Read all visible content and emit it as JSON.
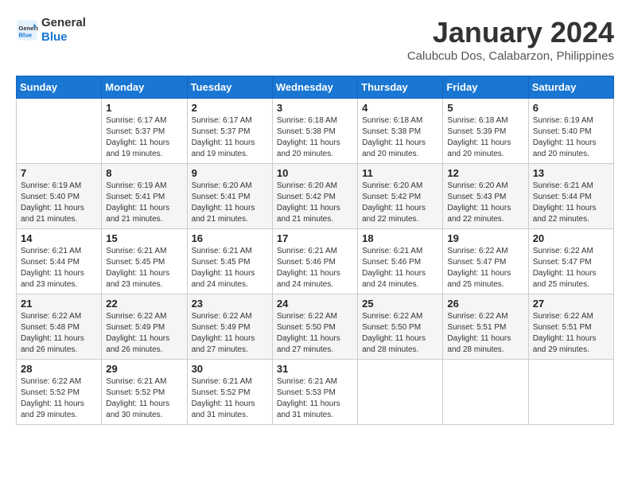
{
  "logo": {
    "line1": "General",
    "line2": "Blue"
  },
  "title": "January 2024",
  "subtitle": "Calubcub Dos, Calabarzon, Philippines",
  "headers": [
    "Sunday",
    "Monday",
    "Tuesday",
    "Wednesday",
    "Thursday",
    "Friday",
    "Saturday"
  ],
  "weeks": [
    [
      {
        "day": "",
        "info": ""
      },
      {
        "day": "1",
        "info": "Sunrise: 6:17 AM\nSunset: 5:37 PM\nDaylight: 11 hours and 19 minutes."
      },
      {
        "day": "2",
        "info": "Sunrise: 6:17 AM\nSunset: 5:37 PM\nDaylight: 11 hours and 19 minutes."
      },
      {
        "day": "3",
        "info": "Sunrise: 6:18 AM\nSunset: 5:38 PM\nDaylight: 11 hours and 20 minutes."
      },
      {
        "day": "4",
        "info": "Sunrise: 6:18 AM\nSunset: 5:38 PM\nDaylight: 11 hours and 20 minutes."
      },
      {
        "day": "5",
        "info": "Sunrise: 6:18 AM\nSunset: 5:39 PM\nDaylight: 11 hours and 20 minutes."
      },
      {
        "day": "6",
        "info": "Sunrise: 6:19 AM\nSunset: 5:40 PM\nDaylight: 11 hours and 20 minutes."
      }
    ],
    [
      {
        "day": "7",
        "info": "Sunrise: 6:19 AM\nSunset: 5:40 PM\nDaylight: 11 hours and 21 minutes."
      },
      {
        "day": "8",
        "info": "Sunrise: 6:19 AM\nSunset: 5:41 PM\nDaylight: 11 hours and 21 minutes."
      },
      {
        "day": "9",
        "info": "Sunrise: 6:20 AM\nSunset: 5:41 PM\nDaylight: 11 hours and 21 minutes."
      },
      {
        "day": "10",
        "info": "Sunrise: 6:20 AM\nSunset: 5:42 PM\nDaylight: 11 hours and 21 minutes."
      },
      {
        "day": "11",
        "info": "Sunrise: 6:20 AM\nSunset: 5:42 PM\nDaylight: 11 hours and 22 minutes."
      },
      {
        "day": "12",
        "info": "Sunrise: 6:20 AM\nSunset: 5:43 PM\nDaylight: 11 hours and 22 minutes."
      },
      {
        "day": "13",
        "info": "Sunrise: 6:21 AM\nSunset: 5:44 PM\nDaylight: 11 hours and 22 minutes."
      }
    ],
    [
      {
        "day": "14",
        "info": "Sunrise: 6:21 AM\nSunset: 5:44 PM\nDaylight: 11 hours and 23 minutes."
      },
      {
        "day": "15",
        "info": "Sunrise: 6:21 AM\nSunset: 5:45 PM\nDaylight: 11 hours and 23 minutes."
      },
      {
        "day": "16",
        "info": "Sunrise: 6:21 AM\nSunset: 5:45 PM\nDaylight: 11 hours and 24 minutes."
      },
      {
        "day": "17",
        "info": "Sunrise: 6:21 AM\nSunset: 5:46 PM\nDaylight: 11 hours and 24 minutes."
      },
      {
        "day": "18",
        "info": "Sunrise: 6:21 AM\nSunset: 5:46 PM\nDaylight: 11 hours and 24 minutes."
      },
      {
        "day": "19",
        "info": "Sunrise: 6:22 AM\nSunset: 5:47 PM\nDaylight: 11 hours and 25 minutes."
      },
      {
        "day": "20",
        "info": "Sunrise: 6:22 AM\nSunset: 5:47 PM\nDaylight: 11 hours and 25 minutes."
      }
    ],
    [
      {
        "day": "21",
        "info": "Sunrise: 6:22 AM\nSunset: 5:48 PM\nDaylight: 11 hours and 26 minutes."
      },
      {
        "day": "22",
        "info": "Sunrise: 6:22 AM\nSunset: 5:49 PM\nDaylight: 11 hours and 26 minutes."
      },
      {
        "day": "23",
        "info": "Sunrise: 6:22 AM\nSunset: 5:49 PM\nDaylight: 11 hours and 27 minutes."
      },
      {
        "day": "24",
        "info": "Sunrise: 6:22 AM\nSunset: 5:50 PM\nDaylight: 11 hours and 27 minutes."
      },
      {
        "day": "25",
        "info": "Sunrise: 6:22 AM\nSunset: 5:50 PM\nDaylight: 11 hours and 28 minutes."
      },
      {
        "day": "26",
        "info": "Sunrise: 6:22 AM\nSunset: 5:51 PM\nDaylight: 11 hours and 28 minutes."
      },
      {
        "day": "27",
        "info": "Sunrise: 6:22 AM\nSunset: 5:51 PM\nDaylight: 11 hours and 29 minutes."
      }
    ],
    [
      {
        "day": "28",
        "info": "Sunrise: 6:22 AM\nSunset: 5:52 PM\nDaylight: 11 hours and 29 minutes."
      },
      {
        "day": "29",
        "info": "Sunrise: 6:21 AM\nSunset: 5:52 PM\nDaylight: 11 hours and 30 minutes."
      },
      {
        "day": "30",
        "info": "Sunrise: 6:21 AM\nSunset: 5:52 PM\nDaylight: 11 hours and 31 minutes."
      },
      {
        "day": "31",
        "info": "Sunrise: 6:21 AM\nSunset: 5:53 PM\nDaylight: 11 hours and 31 minutes."
      },
      {
        "day": "",
        "info": ""
      },
      {
        "day": "",
        "info": ""
      },
      {
        "day": "",
        "info": ""
      }
    ]
  ]
}
